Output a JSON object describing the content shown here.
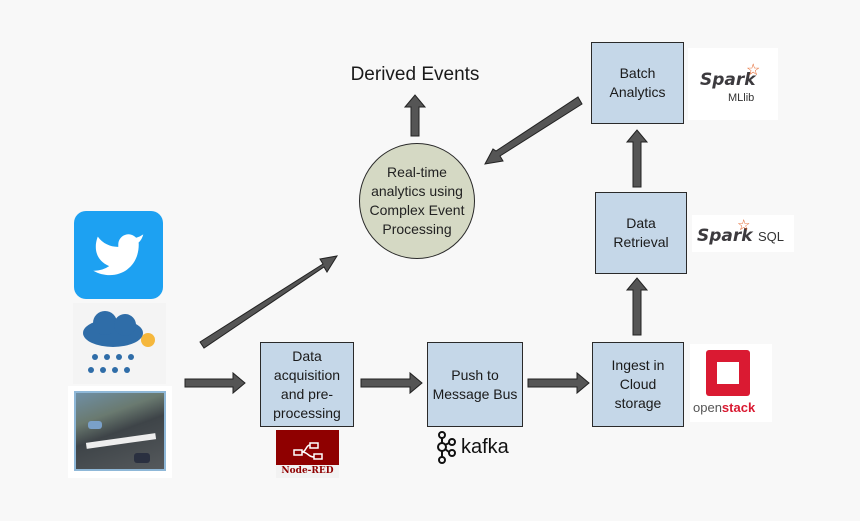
{
  "title": "Derived Events",
  "nodes": {
    "cep": "Real-time\nanalytics using\nComplex Event\nProcessing",
    "acquisition": "Data\nacquisition\nand pre-\nprocessing",
    "message_bus": "Push to\nMessage Bus",
    "ingest": "Ingest in\nCloud\nstorage",
    "retrieval": "Data\nRetrieval",
    "batch": "Batch\nAnalytics"
  },
  "logos": {
    "spark_mllib": {
      "brand": "Spark",
      "suffix": "MLlib"
    },
    "spark_sql": {
      "brand": "Spark",
      "suffix": "SQL"
    },
    "openstack": {
      "part1": "open",
      "part2": "stack"
    },
    "kafka": "kafka",
    "nodered": "Node-RED"
  },
  "sources": [
    "twitter-icon",
    "weather-icon",
    "smart-city-icon"
  ],
  "colors": {
    "box": "#c5d7e8",
    "circle": "#d5d9c4",
    "arrow": "#555555",
    "twitter": "#1da1f2",
    "openstack": "#da1a32",
    "nodered": "#8f0000",
    "spark_star": "#e25a1c"
  }
}
